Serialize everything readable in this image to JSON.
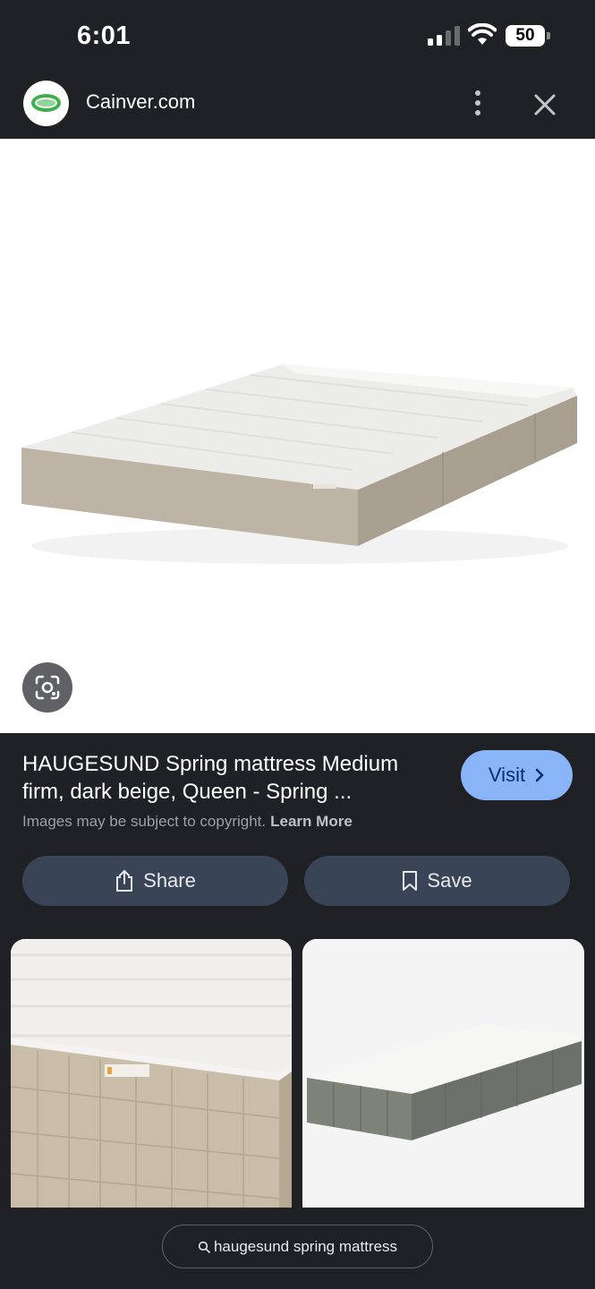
{
  "status_bar": {
    "time": "6:01",
    "battery": "50"
  },
  "header": {
    "site_name": "Cainver.com"
  },
  "result": {
    "title": "HAUGESUND Spring mattress Medium firm, dark beige, Queen - Spring ...",
    "visit_label": "Visit",
    "copyright_text": "Images may be subject to copyright.",
    "learn_more": "Learn More"
  },
  "actions": {
    "share_label": "Share",
    "save_label": "Save"
  },
  "search_chip": {
    "query": "haugesund spring mattress"
  },
  "icons": [
    "signal-icon",
    "wifi-icon",
    "battery-icon",
    "more-vert-icon",
    "close-icon",
    "lens-icon",
    "chevron-right-icon",
    "share-icon",
    "bookmark-icon",
    "search-icon"
  ],
  "colors": {
    "background": "#202124",
    "accent": "#8ab4f8",
    "button": "#394457"
  }
}
